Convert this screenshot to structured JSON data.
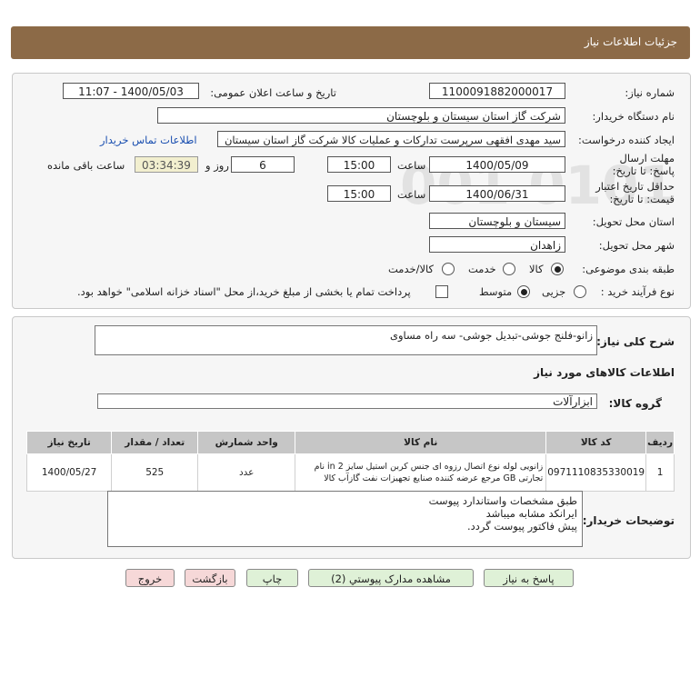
{
  "header": {
    "title": "جزئیات اطلاعات نیاز"
  },
  "fields": {
    "need_number_label": "شماره نیاز:",
    "need_number": "1100091882000017",
    "announce_label": "تاریخ و ساعت اعلان عمومی:",
    "announce_value": "1400/05/03 - 11:07",
    "buyer_org_label": "نام دستگاه خریدار:",
    "buyer_org": "شرکت گاز استان سیستان و بلوچستان",
    "requester_label": "ایجاد کننده درخواست:",
    "requester": "سید مهدی افقهی سرپرست تدارکات و عملیات کالا شرکت گاز استان سیستان",
    "contact_link": "اطلاعات تماس خریدار",
    "deadline_label": "مهلت ارسال پاسخ: تا تاریخ:",
    "deadline_date": "1400/05/09",
    "time_label": "ساعت",
    "deadline_time": "15:00",
    "days": "6",
    "days_label": "روز و",
    "remaining_time": "03:34:39",
    "remaining_label": "ساعت باقی مانده",
    "validity_label": "حداقل تاریخ اعتبار قیمت: تا تاریخ:",
    "validity_date": "1400/06/31",
    "validity_time_label": "ساعت",
    "validity_time": "15:00",
    "province_label": "استان محل تحویل:",
    "province": "سیستان و بلوچستان",
    "city_label": "شهر محل تحویل:",
    "city": "زاهدان",
    "category_label": "طبقه بندی موضوعی:",
    "category_options": [
      "کالا",
      "خدمت",
      "کالا/خدمت"
    ],
    "process_label": "نوع فرآیند خرید :",
    "process_options": [
      "جزیی",
      "متوسط"
    ],
    "payment_note": "پرداخت تمام یا بخشی از مبلغ خرید،از محل \"اسناد خزانه اسلامی\" خواهد بود."
  },
  "summary": {
    "label": "شرح کلی نیاز:",
    "value": "زانو-فلنج جوشی-تبدیل جوشی- سه راه مساوی",
    "goods_info_title": "اطلاعات کالاهای مورد نیاز",
    "group_label": "گروه کالا:",
    "group_value": "ابزارآلات"
  },
  "table": {
    "headers": [
      "ردیف",
      "کد کالا",
      "نام کالا",
      "واحد شمارش",
      "تعداد / مقدار",
      "تاریخ نیاز"
    ],
    "rows": [
      {
        "row": "1",
        "code": "0971110835330019",
        "name": "زانویی لوله نوع اتصال رزوه ای جنس کربن استیل سایز in 2 نام تجارتی GB مرجع عرضه کننده صنایع تجهیزات نفت گازآب کالا",
        "unit": "عدد",
        "qty": "525",
        "date": "1400/05/27"
      }
    ]
  },
  "buyer_notes": {
    "label": "توضیحات خریدار:",
    "lines": [
      "طبق مشخصات واستاندارد پیوست",
      "ایرانکد مشابه میباشد",
      "پیش فاکتور پیوست گردد."
    ]
  },
  "buttons": {
    "reply": "پاسخ به نیاز",
    "view_docs": "مشاهده مدارک پیوستي (2)",
    "print": "چاپ",
    "back": "بازگشت",
    "exit": "خروج"
  }
}
